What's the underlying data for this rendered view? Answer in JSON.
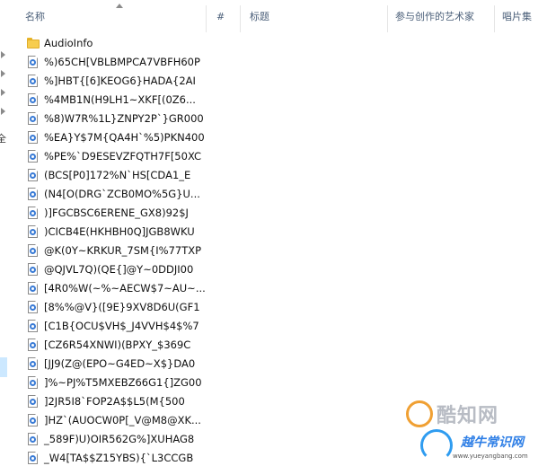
{
  "columns": {
    "name": "名称",
    "number": "#",
    "title": "标题",
    "artists": "参与创作的艺术家",
    "album": "唱片集"
  },
  "nav_partial_label": "全",
  "files": [
    {
      "name": "AudioInfo",
      "type": "folder"
    },
    {
      "name": "%)65CH[VBLBMPCA7VBFH60P",
      "type": "audio"
    },
    {
      "name": "%]HBT{[6]KEOG6}HADA{2AI",
      "type": "audio"
    },
    {
      "name": "%4MB1N(H9LH1~XKF[(0Z6...",
      "type": "audio"
    },
    {
      "name": "%8)W7R%1L}ZNPY2P`}GR000",
      "type": "audio"
    },
    {
      "name": "%EA}Y$7M{QA4H`%5)PKN400",
      "type": "audio"
    },
    {
      "name": "%PE%`D9ESEVZFQTH7F[50XC",
      "type": "audio"
    },
    {
      "name": "(BCS[P0]172%N`HS[CDA1_E",
      "type": "audio"
    },
    {
      "name": "(N4[O(DRG`ZCB0MO%5G}U...",
      "type": "audio"
    },
    {
      "name": ")]FGCBSC6ERENE_GX8)92$J",
      "type": "audio"
    },
    {
      "name": ")CICB4E(HKHBH0Q]JGB8WKU",
      "type": "audio"
    },
    {
      "name": "@K(0Y~KRKUR_7SM{I%77TXP",
      "type": "audio"
    },
    {
      "name": "@QJVL7Q)(QE{]@Y~0DDJI00",
      "type": "audio"
    },
    {
      "name": "[4R0%W(~%~AECW$7~AU~...",
      "type": "audio"
    },
    {
      "name": "[8%%@V}([9E}9XV8D6U(GF1",
      "type": "audio"
    },
    {
      "name": "[C1B{OCU$VH$_J4VVH$4$%7",
      "type": "audio"
    },
    {
      "name": "[CZ6R54XNWI)(BPXY_$369C",
      "type": "audio"
    },
    {
      "name": "[JJ9(Z@(EPO~G4ED~X$}DA0",
      "type": "audio"
    },
    {
      "name": "]%~PJ%T5MXEBZ66G1{]ZG00",
      "type": "audio"
    },
    {
      "name": "]2JR5I8`FOP2A$$L5(M{500",
      "type": "audio"
    },
    {
      "name": "]HZ`(AUOCW0P[_V@M8@XK...",
      "type": "audio"
    },
    {
      "name": "_589F)U)OIR562G%]XUHAG8",
      "type": "audio"
    },
    {
      "name": "_W4[TA$$Z15YBS){`L3CCGB",
      "type": "audio"
    }
  ],
  "watermark": {
    "brand": "酷知网",
    "brand2": "越牛常识网",
    "url": "www.yueyangbang.com"
  }
}
